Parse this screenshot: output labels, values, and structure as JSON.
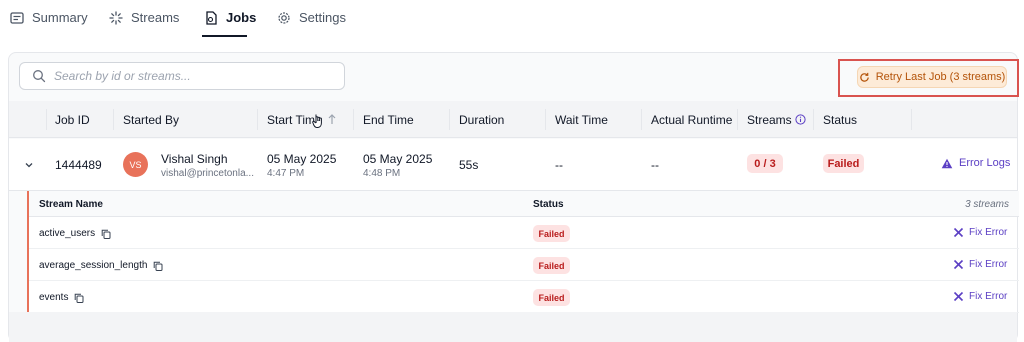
{
  "tabs": [
    {
      "label": "Summary",
      "icon": "summary-icon"
    },
    {
      "label": "Streams",
      "icon": "streams-icon"
    },
    {
      "label": "Jobs",
      "icon": "jobs-icon",
      "active": true
    },
    {
      "label": "Settings",
      "icon": "gear-icon"
    }
  ],
  "search": {
    "placeholder": "Search by id or streams..."
  },
  "retry_button": {
    "label": "Retry Last Job (3 streams)",
    "icon": "refresh-icon"
  },
  "table": {
    "headers": {
      "job_id": "Job ID",
      "started_by": "Started By",
      "start_time": "Start Time",
      "end_time": "End Time",
      "duration": "Duration",
      "wait_time": "Wait Time",
      "actual_runtime": "Actual Runtime",
      "streams": "Streams",
      "status": "Status"
    },
    "rows": [
      {
        "job_id": "1444489",
        "avatar": "VS",
        "user_name": "Vishal Singh",
        "user_email": "vishal@princetonla...",
        "start_date": "05 May 2025",
        "start_time": "4:47 PM",
        "end_date": "05 May 2025",
        "end_time": "4:48 PM",
        "duration": "55s",
        "wait_time": "--",
        "actual_runtime": "--",
        "streams": "0 / 3",
        "status": "Failed",
        "action": "Error Logs"
      }
    ]
  },
  "stream_table": {
    "headers": {
      "name": "Stream Name",
      "status": "Status"
    },
    "count": "3 streams",
    "rows": [
      {
        "name": "active_users",
        "status": "Failed",
        "action": "Fix Error"
      },
      {
        "name": "average_session_length",
        "status": "Failed",
        "action": "Fix Error"
      },
      {
        "name": "events",
        "status": "Failed",
        "action": "Fix Error"
      }
    ]
  },
  "colors": {
    "accent": "#5b3fc4",
    "failed_bg": "#fde2e2",
    "failed_text": "#b91c1c",
    "retry_bg": "#fdebd8",
    "highlight": "#d9534f"
  }
}
